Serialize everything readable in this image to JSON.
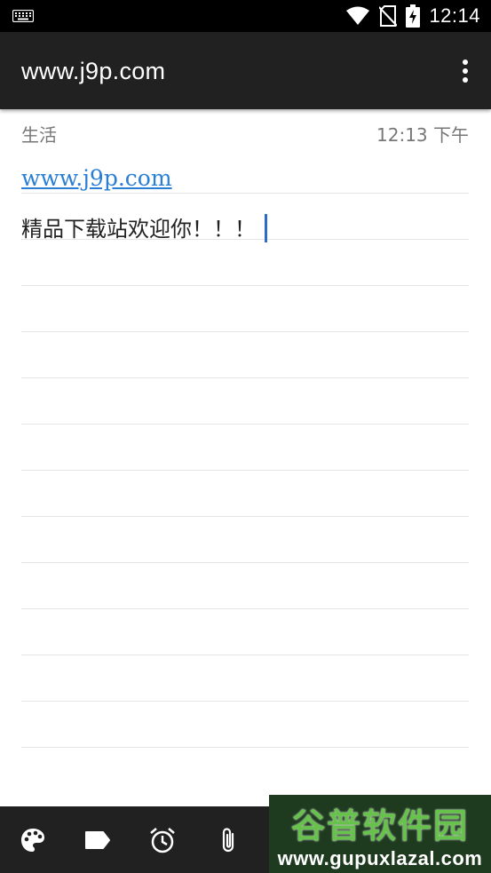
{
  "status_bar": {
    "time": "12:14"
  },
  "app_bar": {
    "title": "www.j9p.com"
  },
  "note": {
    "category": "生活",
    "timestamp": "12:13 下午",
    "link": "www.j9p.com",
    "body": "精品下载站欢迎你！！！"
  },
  "watermark": {
    "brand": "谷普软件园",
    "url": "www.gupuxlazal.com"
  },
  "colors": {
    "app_bar": "#212121",
    "status_bar": "#000000",
    "link": "#2a7fd4",
    "caret": "#2a6cc7",
    "watermark_green": "#66c24a"
  },
  "icons": {
    "status": [
      "keyboard-icon",
      "wifi-icon",
      "no-sim-icon",
      "battery-charging-icon"
    ],
    "app_bar": [
      "more-vert-icon"
    ],
    "bottom_bar": [
      "palette-icon",
      "label-icon",
      "alarm-icon",
      "attachment-icon"
    ]
  }
}
